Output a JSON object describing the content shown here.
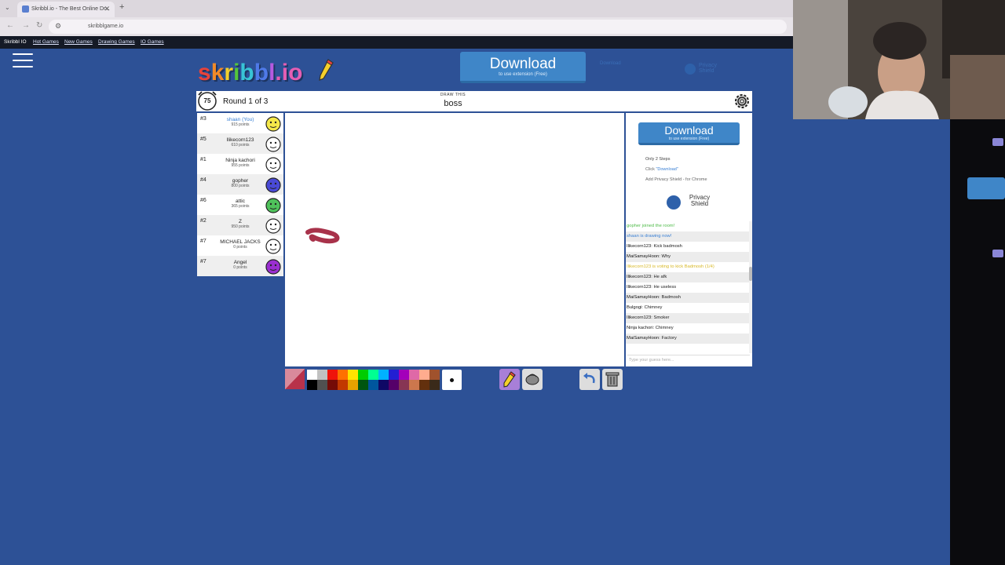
{
  "browser": {
    "tab_title": "Skribbl.io - The Best Online Dr...",
    "new_tab": "+",
    "url": "skribblgame.io"
  },
  "site_nav": {
    "brand": "Skribbl IO",
    "links": [
      "Hot Games",
      "New Games",
      "Drawing Games",
      "IO Games"
    ]
  },
  "logo": {
    "parts": [
      "s",
      "k",
      "r",
      "i",
      "b",
      "b",
      "l",
      ".io"
    ]
  },
  "top_download": {
    "label": "Download",
    "sub": "to use extension (Free)",
    "ghost": "Download"
  },
  "top_shield": {
    "line1": "Privacy",
    "line2": "Shield"
  },
  "game": {
    "timer": "75",
    "round": "Round 1 of 3",
    "draw_this": "DRAW THIS",
    "word": "boss"
  },
  "players": [
    {
      "rank": "#3",
      "name": "shaan (You)",
      "points": "915 points",
      "me": true,
      "color": "#f5e84a"
    },
    {
      "rank": "#5",
      "name": "Ilikecorn123",
      "points": "610 points",
      "me": false,
      "color": "#ffffff"
    },
    {
      "rank": "#1",
      "name": "Ninja kachori",
      "points": "955 points",
      "me": false,
      "color": "#ffffff"
    },
    {
      "rank": "#4",
      "name": "gopher",
      "points": "800 points",
      "me": false,
      "color": "#4a4ad6"
    },
    {
      "rank": "#6",
      "name": "attic",
      "points": "365 points",
      "me": false,
      "color": "#4fc25b"
    },
    {
      "rank": "#2",
      "name": "Z",
      "points": "950 points",
      "me": false,
      "color": "#ffffff"
    },
    {
      "rank": "#7",
      "name": "MICHAEL JACKS",
      "points": "0 points",
      "me": false,
      "color": "#ffffff"
    },
    {
      "rank": "#7",
      "name": "Angel",
      "points": "0 points",
      "me": false,
      "color": "#9b2fd1"
    }
  ],
  "side_ad": {
    "download": "Download",
    "download_sub": "to use extension (Free)",
    "steps_title": "Only 2 Steps",
    "step1_prefix": "Click ",
    "step1_link": "\"Download\"",
    "step2": "Add Privacy Shield - for Chrome",
    "shield1": "Privacy",
    "shield2": "Shield"
  },
  "chat": [
    {
      "type": "sys-green",
      "who": "",
      "text": "gopher joined the room!"
    },
    {
      "type": "sys-blue",
      "who": "",
      "text": "shaan is drawing now!"
    },
    {
      "type": "msg",
      "who": "Ilikecorn123:",
      "text": "Kick badmosh"
    },
    {
      "type": "msg",
      "who": "MaiSamayHoon:",
      "text": "Why"
    },
    {
      "type": "sys-yellow",
      "who": "",
      "text": "Ilikecorn123 is voting to kick Badmosh (1/4)"
    },
    {
      "type": "msg",
      "who": "Ilikecorn123:",
      "text": "He afk"
    },
    {
      "type": "msg",
      "who": "Ilikecorn123:",
      "text": "He useless"
    },
    {
      "type": "msg",
      "who": "MaiSamayHoon:",
      "text": "Badmosh"
    },
    {
      "type": "msg",
      "who": "Bulgogi:",
      "text": "Chimney"
    },
    {
      "type": "msg",
      "who": "Ilikecorn123:",
      "text": "Smoker"
    },
    {
      "type": "msg",
      "who": "Ninja kachori:",
      "text": "Chimney"
    },
    {
      "type": "msg",
      "who": "MaiSamayHoon:",
      "text": "Factory"
    }
  ],
  "chat_placeholder": "Type your guess here...",
  "palette": {
    "row1": [
      "#ffffff",
      "#c1c1c1",
      "#ef130b",
      "#ff7100",
      "#ffe400",
      "#00cc00",
      "#00ff91",
      "#00b2ff",
      "#231fd3",
      "#a300ba",
      "#df69a7",
      "#ffac8e",
      "#a0522d"
    ],
    "row2": [
      "#000000",
      "#505050",
      "#740b07",
      "#c23800",
      "#e8a200",
      "#005510",
      "#00569e",
      "#0e0865",
      "#550069",
      "#873554",
      "#cc774d",
      "#63300d",
      "#3a2a1a"
    ]
  },
  "tools": [
    "pencil-icon",
    "fill-icon",
    "undo-icon",
    "trash-icon"
  ],
  "canvas_stroke_color": "#a8324a"
}
